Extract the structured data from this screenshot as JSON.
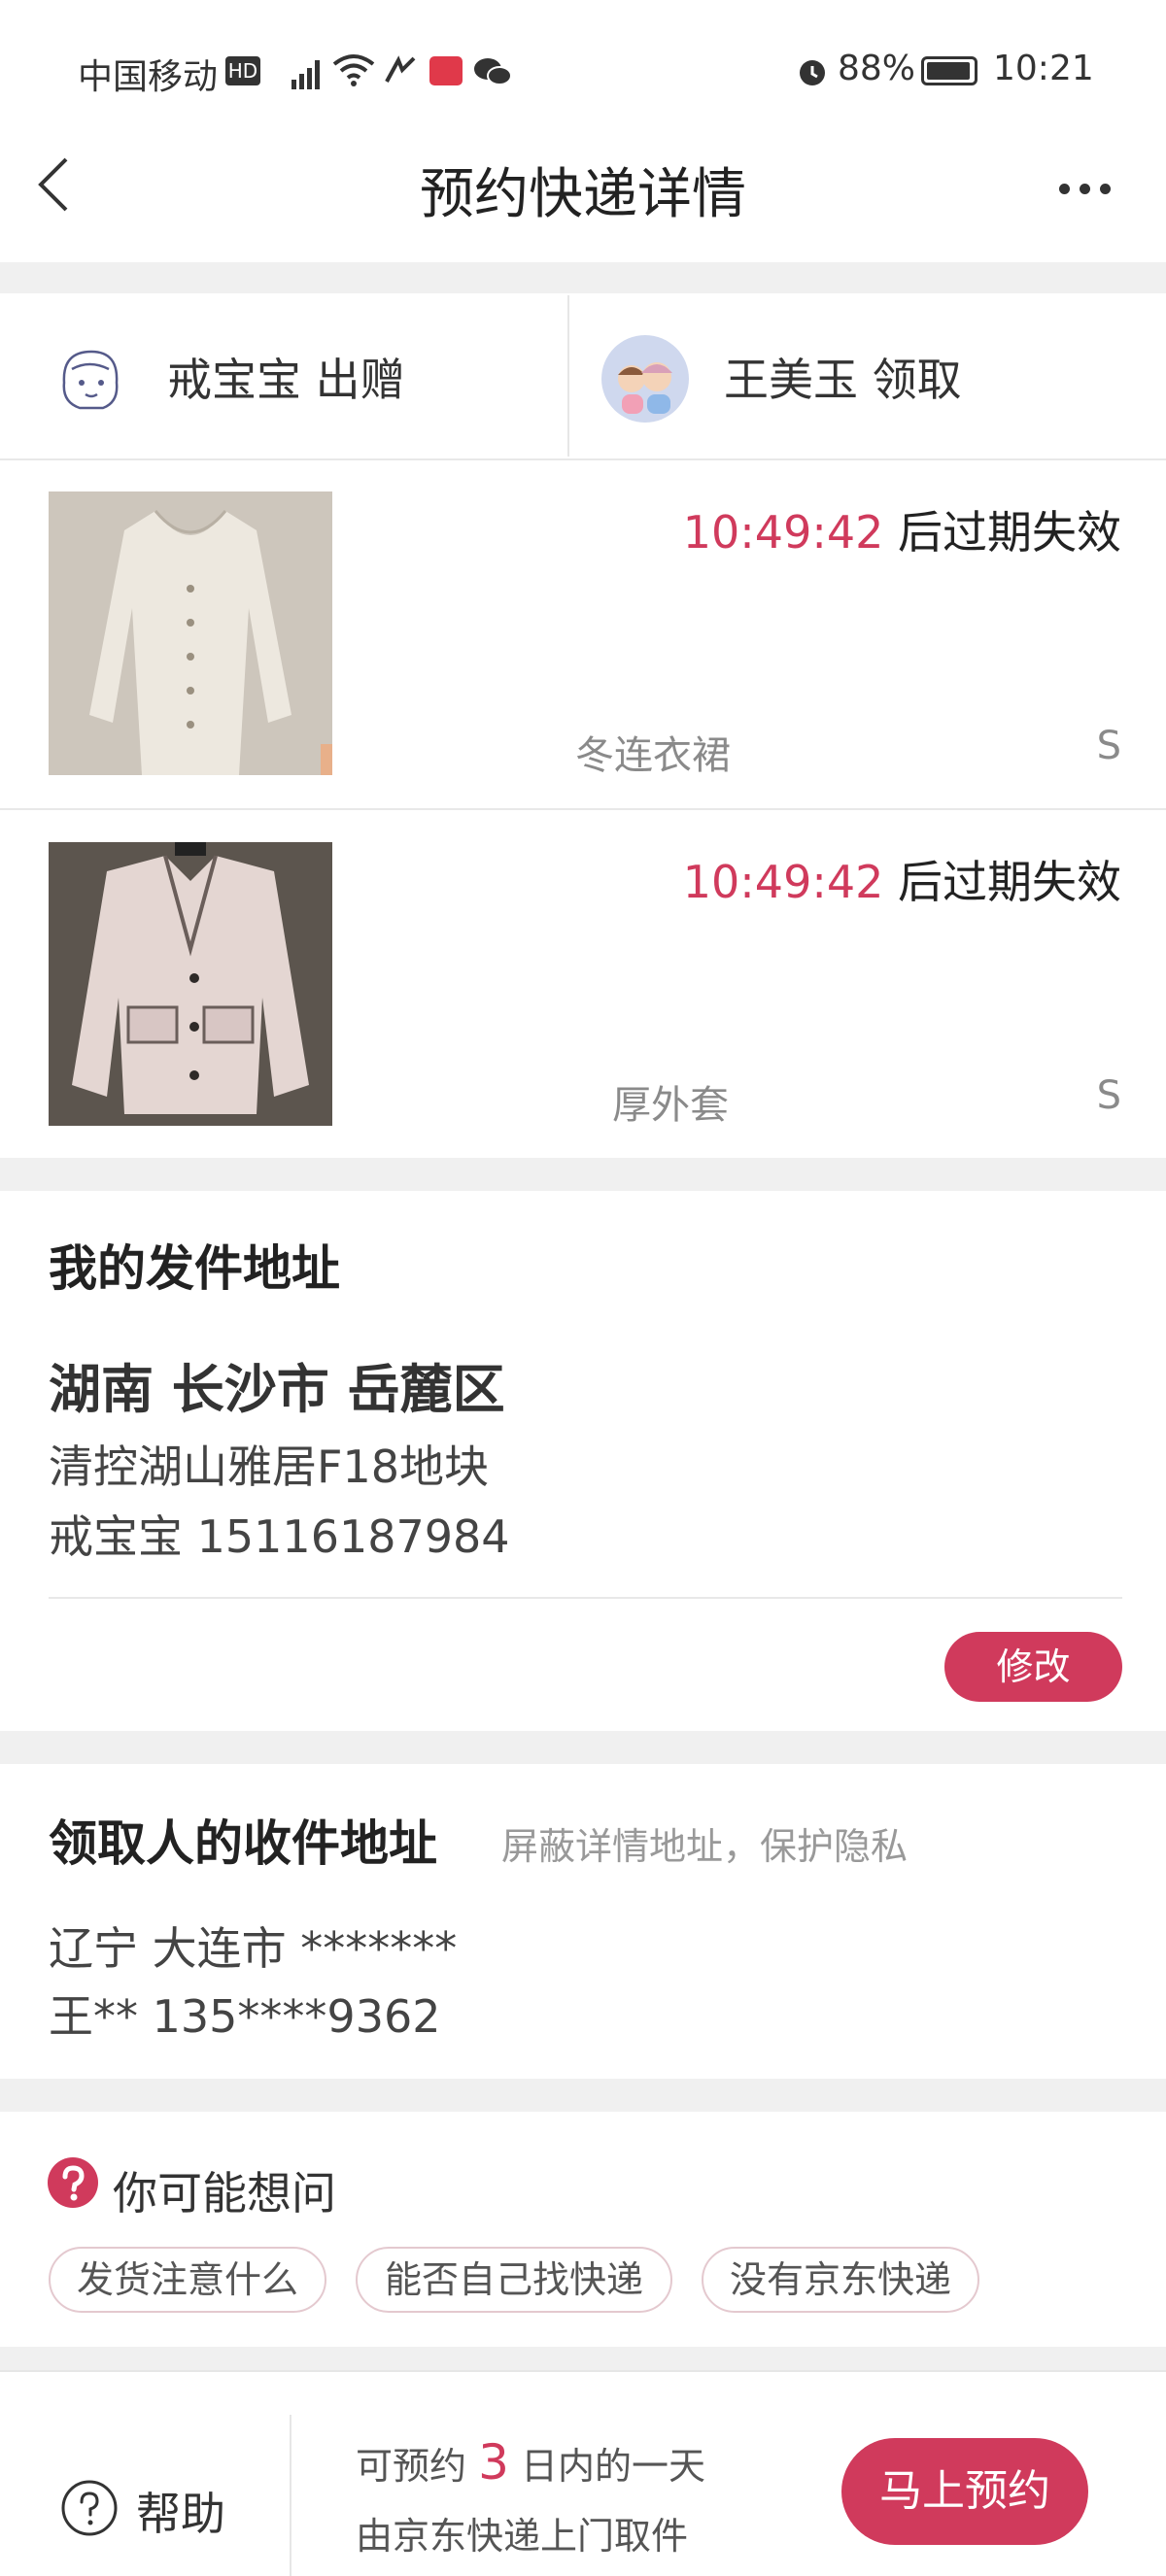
{
  "status_bar": {
    "carrier": "中国移动",
    "battery": "88%",
    "time": "10:21"
  },
  "header": {
    "title": "预约快递详情"
  },
  "parties": {
    "giver": {
      "name": "戒宝宝",
      "action": "出赠"
    },
    "receiver": {
      "name": "王美玉",
      "action": "领取"
    }
  },
  "items": [
    {
      "countdown": "10:49:42",
      "expire_text": "后过期失效",
      "name": "冬连衣裙",
      "size": "S"
    },
    {
      "countdown": "10:49:42",
      "expire_text": "后过期失效",
      "name": "厚外套",
      "size": "S"
    }
  ],
  "sender": {
    "title": "我的发件地址",
    "region": "湖南 长沙市 岳麓区",
    "street": "清控湖山雅居F18地块",
    "contact": "戒宝宝 15116187984",
    "edit_label": "修改"
  },
  "receiver_address": {
    "title": "领取人的收件地址",
    "hint": "屏蔽详情地址，保护隐私",
    "region": "辽宁 大连市 *******",
    "contact": "王** 135****9362"
  },
  "faq": {
    "title": "你可能想问",
    "chips": [
      "发货注意什么",
      "能否自己找快递",
      "没有京东快递"
    ]
  },
  "bottom_bar": {
    "help_label": "帮助",
    "line1_prefix": "可预约",
    "days": "3",
    "line1_suffix": "日内的一天",
    "line2": "由京东快递上门取件",
    "book_label": "马上预约"
  },
  "colors": {
    "accent": "#d03a5c",
    "background": "#f0f0f0"
  }
}
